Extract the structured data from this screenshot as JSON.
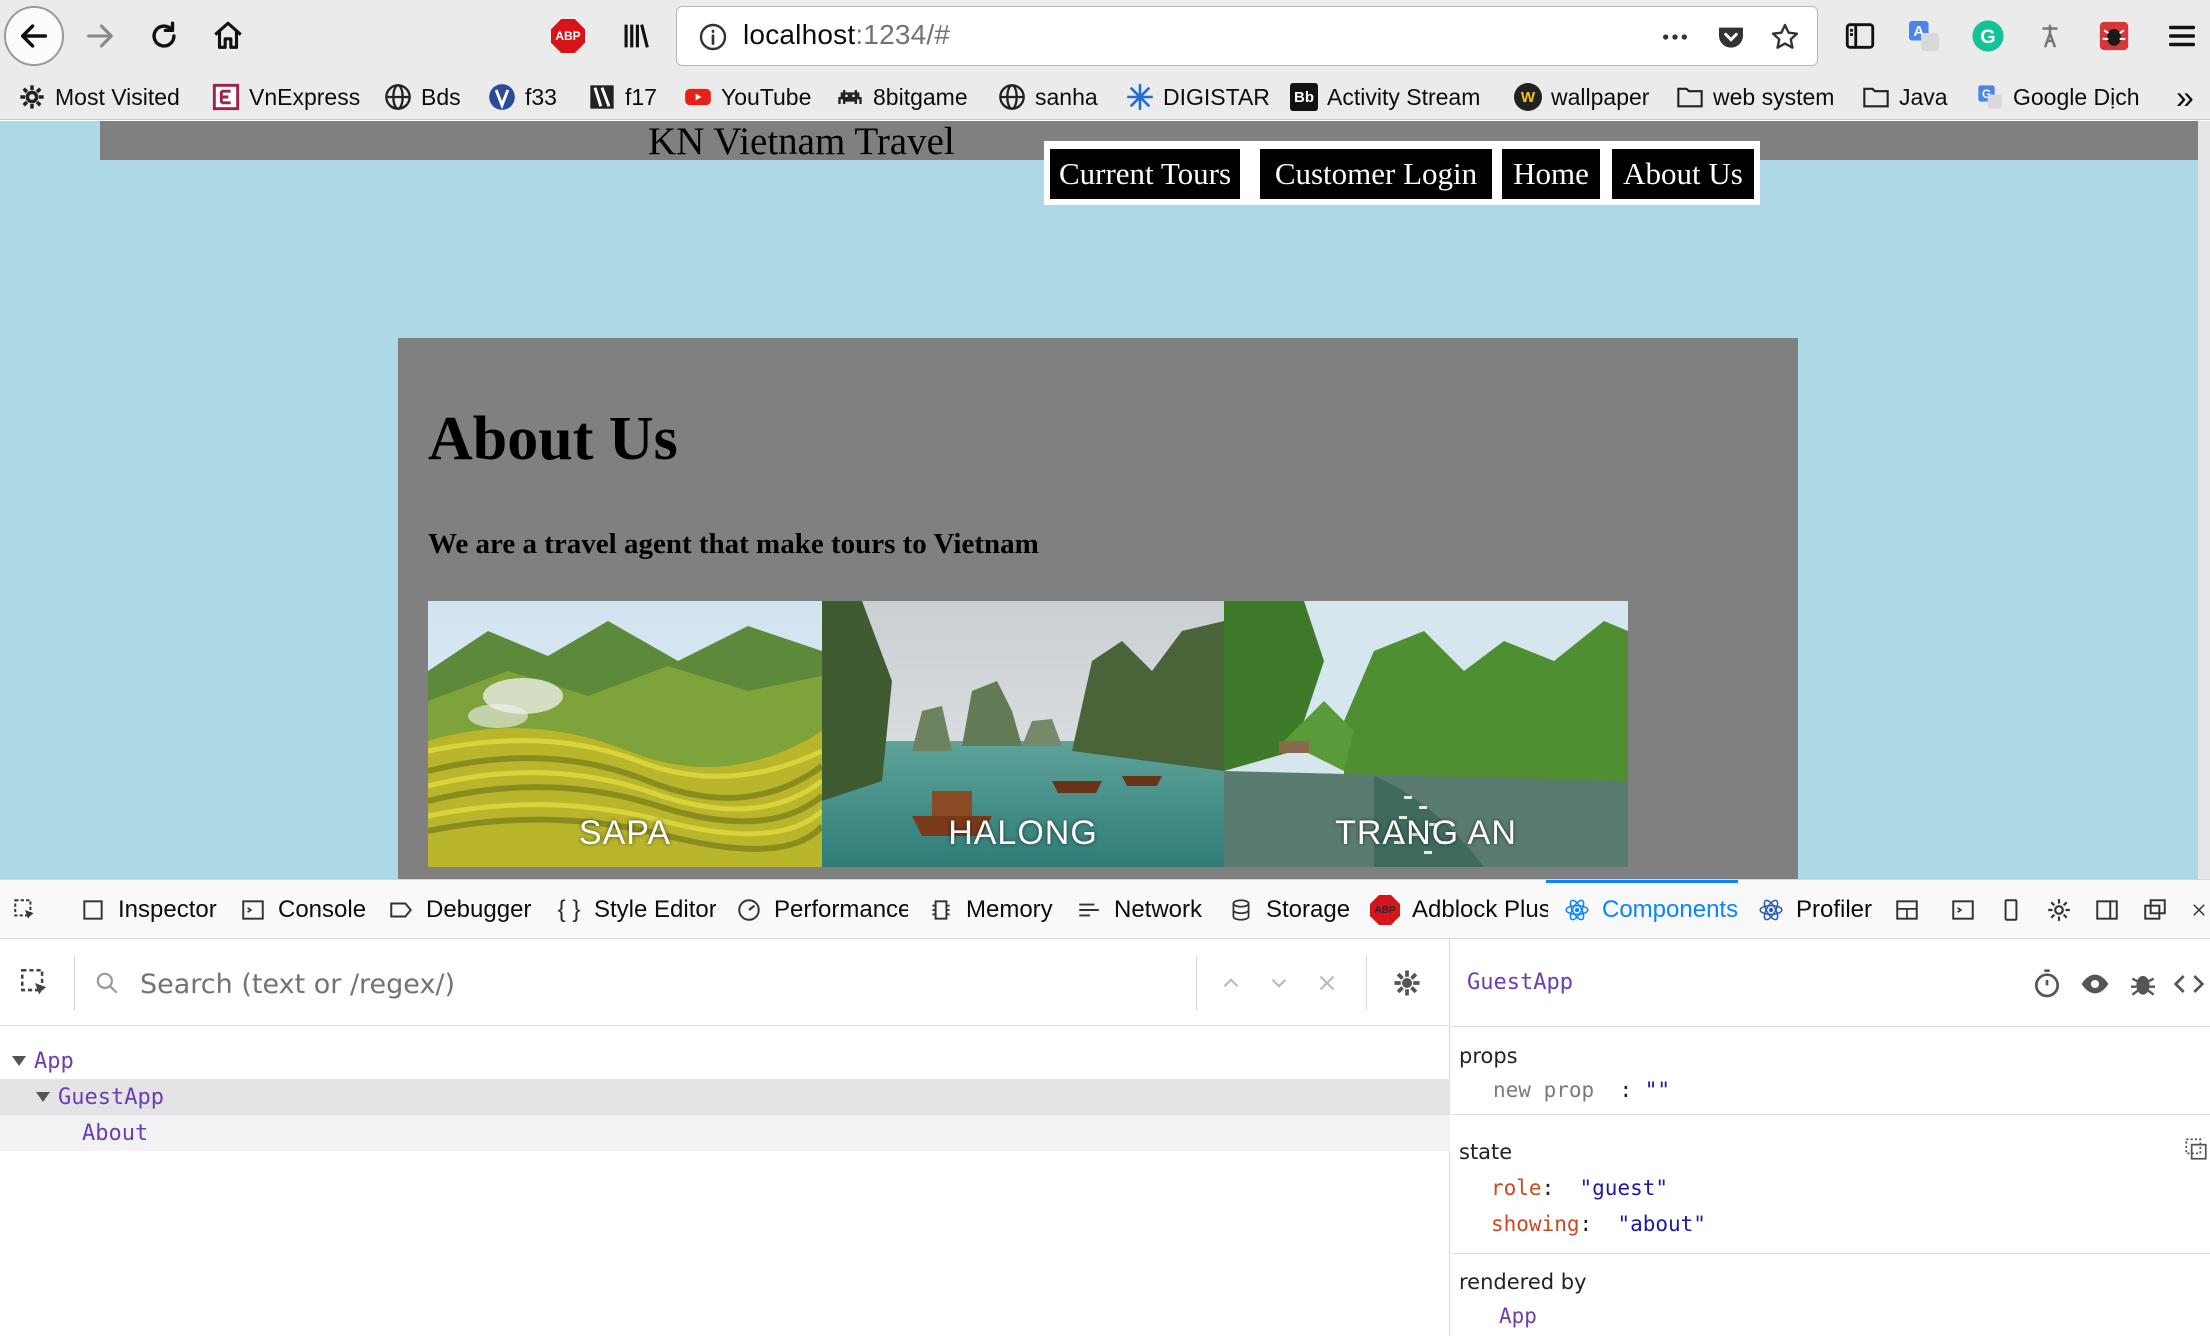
{
  "browser": {
    "url_host": "localhost",
    "url_rest": ":1234/#",
    "bookmarks": [
      {
        "label": "Most Visited",
        "icon": "gear-icon"
      },
      {
        "label": "VnExpress",
        "icon": "vnexpress-icon"
      },
      {
        "label": "Bds",
        "icon": "globe-icon"
      },
      {
        "label": "f33",
        "icon": "f33-icon"
      },
      {
        "label": "f17",
        "icon": "f17-icon"
      },
      {
        "label": "YouTube",
        "icon": "youtube-icon"
      },
      {
        "label": "8bitgame",
        "icon": "invader-icon"
      },
      {
        "label": "sanha",
        "icon": "globe-icon"
      },
      {
        "label": "DIGISTAR",
        "icon": "star-icon"
      },
      {
        "label": "Activity Stream",
        "icon": "bb-icon"
      },
      {
        "label": "wallpaper",
        "icon": "w-icon"
      },
      {
        "label": "web system",
        "icon": "folder-icon"
      },
      {
        "label": "Java",
        "icon": "folder-icon"
      },
      {
        "label": "Google Dịch",
        "icon": "translate-icon"
      }
    ],
    "abp_label": "ABP",
    "bb_label": "Bb",
    "w_label": "W",
    "overflow_label": "»"
  },
  "site": {
    "title": "KN Vietnam Travel",
    "nav": [
      "Current Tours",
      "Customer Login",
      "Home",
      "About Us"
    ],
    "heading": "About Us",
    "tagline": "We are a travel agent that make tours to Vietnam",
    "photos": [
      "SAPA",
      "HALONG",
      "TRANG AN"
    ],
    "colors": {
      "page_bg": "#add8e6",
      "panel_bg": "#808080",
      "nav_bg": "#000000"
    }
  },
  "devtools": {
    "tabs": [
      "Inspector",
      "Console",
      "Debugger",
      "Style Editor",
      "Performance",
      "Memory",
      "Network",
      "Storage",
      "Adblock Plus",
      "Components",
      "Profiler"
    ],
    "search_placeholder": "Search (text or /regex/)",
    "tree": [
      "App",
      "GuestApp",
      "About"
    ],
    "selected_component": "GuestApp",
    "props_label": "props",
    "props": [
      {
        "key": "new prop",
        "value": "\"\""
      }
    ],
    "state_label": "state",
    "state": [
      {
        "key": "role",
        "value": "\"guest\""
      },
      {
        "key": "showing",
        "value": "\"about\""
      }
    ],
    "rendered_by_label": "rendered by",
    "rendered_by": "App"
  }
}
